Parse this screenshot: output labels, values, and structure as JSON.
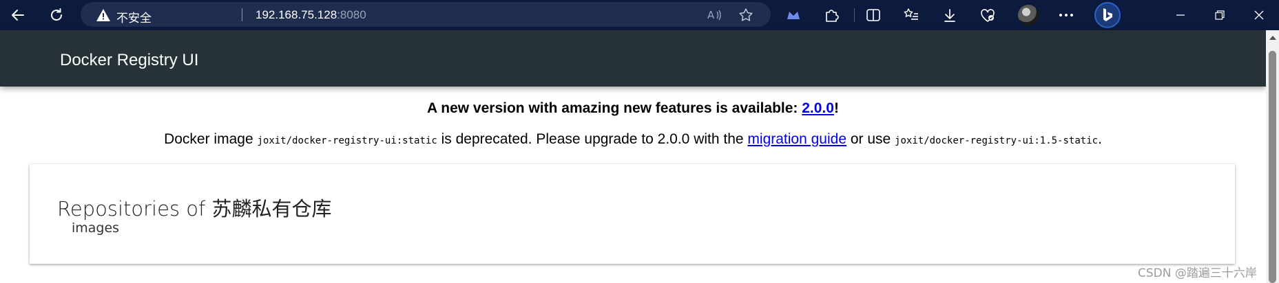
{
  "browser": {
    "security_label": "不安全",
    "url_host": "192.168.75.128",
    "url_port": ":8080"
  },
  "app": {
    "title": "Docker Registry UI"
  },
  "notice": {
    "new_version_text": "A new version with amazing new features is available: ",
    "new_version_link": "2.0.0",
    "new_version_suffix": "!",
    "deprecated_prefix": "Docker image ",
    "deprecated_image": "joxit/docker-registry-ui:static",
    "deprecated_middle": " is deprecated. Please upgrade to 2.0.0 with the ",
    "migration_link": "migration guide",
    "deprecated_or_use": " or use ",
    "alternative_image": "joxit/docker-registry-ui:1.5-static",
    "deprecated_end": "."
  },
  "repositories": {
    "title": "Repositories of 苏麟私有仓库",
    "items": [
      {
        "name": "images"
      }
    ]
  },
  "watermark": "CSDN @踏遍三十六岸",
  "colors": {
    "browser_bg": "#0c1a3d",
    "address_bg": "#1f2d50",
    "header_bg": "#263238",
    "link": "#0000ee"
  }
}
